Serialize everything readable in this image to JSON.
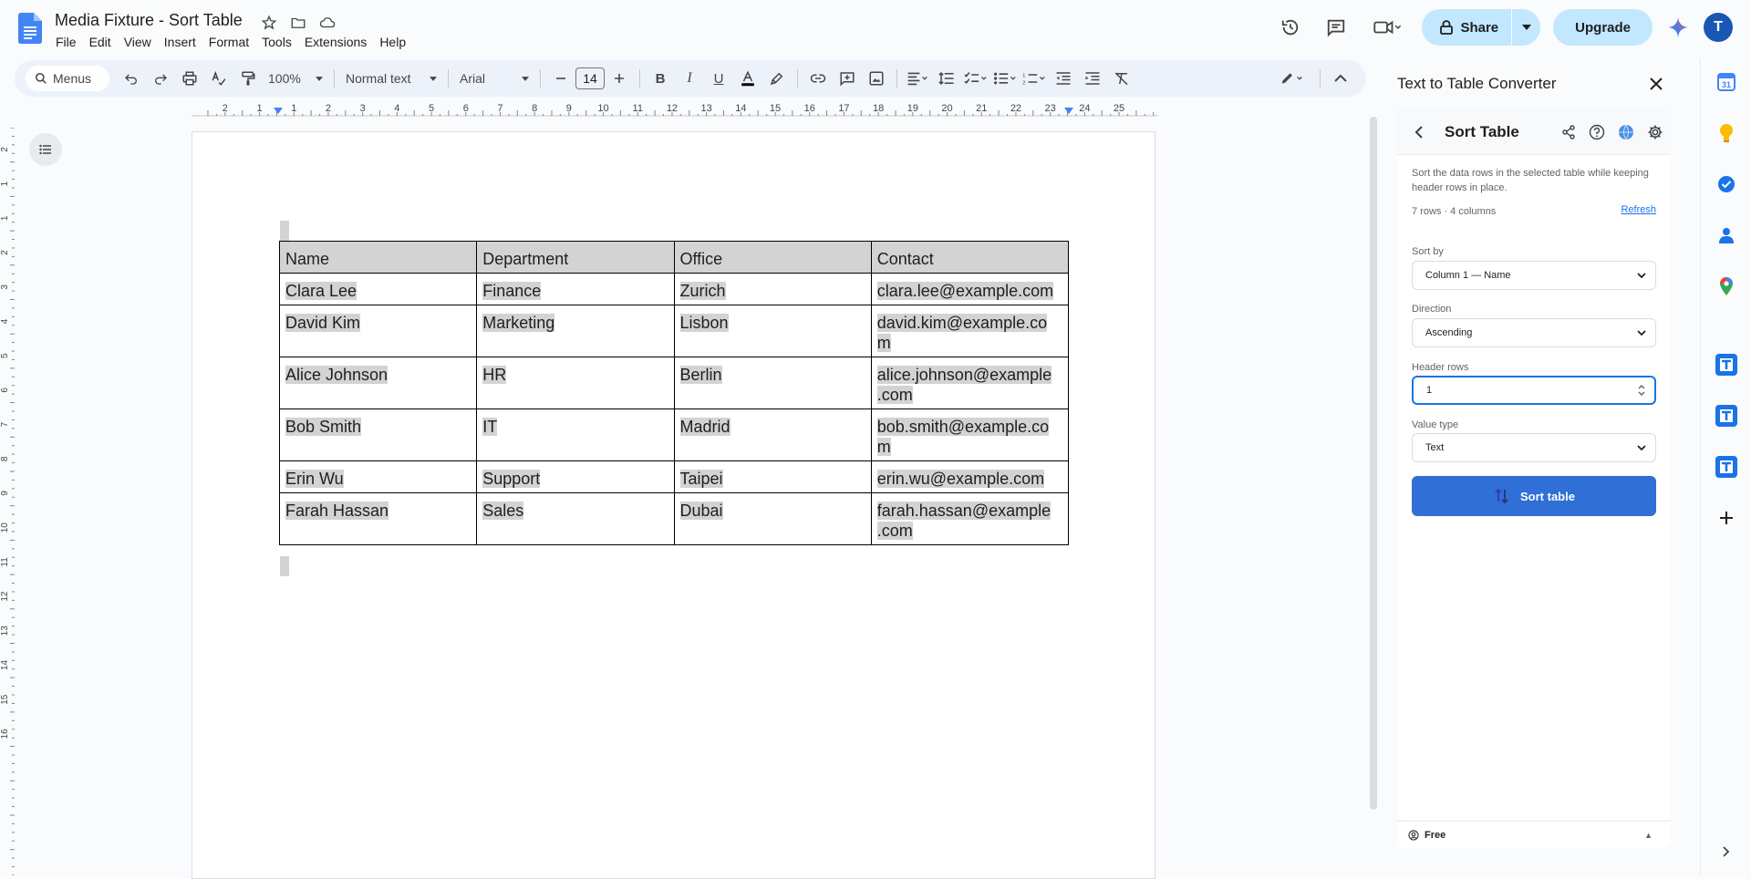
{
  "doc": {
    "title": "Media Fixture - Sort Table",
    "menus": [
      "File",
      "Edit",
      "View",
      "Insert",
      "Format",
      "Tools",
      "Extensions",
      "Help"
    ]
  },
  "header": {
    "share_label": "Share",
    "upgrade_label": "Upgrade",
    "avatar_letter": "T"
  },
  "toolbar": {
    "search_label": "Menus",
    "zoom": "100%",
    "style": "Normal text",
    "font": "Arial",
    "font_size": "14"
  },
  "ruler": {
    "marks": [
      "2",
      "1",
      "1",
      "2",
      "3",
      "4",
      "5",
      "6",
      "7",
      "8",
      "9",
      "10",
      "11",
      "12",
      "13",
      "14",
      "15",
      "16",
      "17",
      "18",
      "19",
      "20",
      "21",
      "22",
      "23",
      "24",
      "25"
    ],
    "vmarks": [
      "2",
      "1",
      "1",
      "2",
      "3",
      "4",
      "5",
      "6",
      "7",
      "8",
      "9",
      "10",
      "11",
      "12",
      "13",
      "14",
      "15",
      "16"
    ]
  },
  "table": {
    "header": [
      "Name",
      "Department",
      "Office",
      "Contact"
    ],
    "rows": [
      [
        "Clara Lee",
        "Finance",
        "Zurich",
        "clara.lee@example.com"
      ],
      [
        "David Kim",
        "Marketing",
        "Lisbon",
        "david.kim@example.co m"
      ],
      [
        "Alice Johnson",
        "HR",
        "Berlin",
        "alice.johnson@example .com"
      ],
      [
        "Bob Smith",
        "IT",
        "Madrid",
        "bob.smith@example.co m"
      ],
      [
        "Erin Wu",
        "Support",
        "Taipei",
        "erin.wu@example.com"
      ],
      [
        "Farah Hassan",
        "Sales",
        "Dubai",
        "farah.hassan@example .com"
      ]
    ]
  },
  "panel": {
    "title": "Text to Table Converter",
    "card_title": "Sort Table",
    "description": "Sort the data rows in the selected table while keeping header rows in place.",
    "row_count": "7 rows · 4 columns",
    "refresh_label": "Refresh",
    "sort_by_label": "Sort by",
    "sort_by_value": "Column 1 — Name",
    "direction_label": "Direction",
    "direction_value": "Ascending",
    "header_rows_label": "Header rows",
    "header_rows_value": "1",
    "value_type_label": "Value type",
    "value_type_value": "Text",
    "sort_button": "Sort table",
    "plan": "Free"
  },
  "colors": {
    "accent": "#2f6fd6",
    "share_bg": "#c2e7ff",
    "cell_highlight": "#d3d3d3"
  }
}
